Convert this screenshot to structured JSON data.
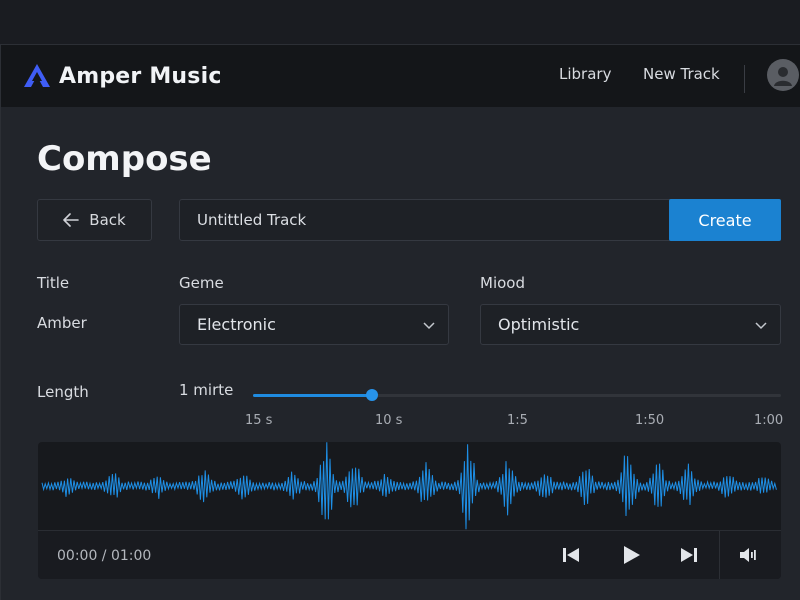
{
  "app": {
    "name": "Amper Music"
  },
  "nav": {
    "library": "Library",
    "new_track": "New Track"
  },
  "page": {
    "title": "Compose"
  },
  "toolbar": {
    "back_label": "Back",
    "title_value": "Untittled Track",
    "create_label": "Create"
  },
  "form": {
    "title_label": "Title",
    "title_value": "Amber",
    "genre_label": "Geme",
    "genre_value": "Electronic",
    "mood_label": "Miood",
    "mood_value": "Optimistic",
    "length_label": "Length",
    "length_value": "1 mirte",
    "length_fraction": 0.226,
    "ticks": [
      "15 s",
      "10 s",
      "1:5",
      "1:50",
      "1:00"
    ]
  },
  "player": {
    "time": "00:00 / 01:00"
  },
  "icons": [
    "amper-logo-icon",
    "avatar-user-icon",
    "arrow-left-icon",
    "chevron-down-icon",
    "skip-back-icon",
    "play-icon",
    "skip-forward-icon",
    "volume-icon"
  ],
  "colors": {
    "accent": "#1b82d1",
    "waveform": "#1e8fe6",
    "background": "#22252b",
    "navbar": "#141619"
  }
}
